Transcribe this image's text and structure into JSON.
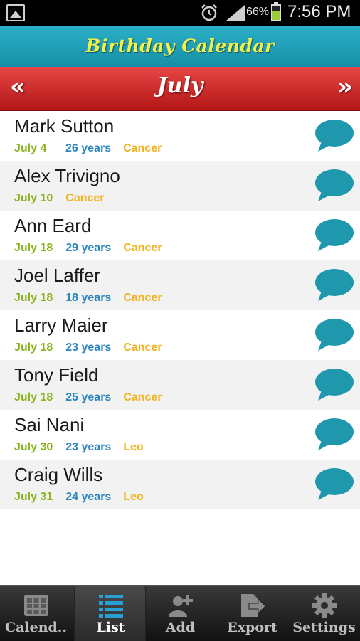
{
  "status_bar": {
    "battery_percent": "66%",
    "time": "7:56 PM",
    "icons": [
      "gallery-icon",
      "alarm-icon",
      "signal-icon",
      "battery-icon"
    ]
  },
  "header": {
    "title": "Birthday Calendar"
  },
  "month_nav": {
    "prev_label": "«",
    "month": "July",
    "next_label": "»"
  },
  "colors": {
    "title_bar": "#1a9db5",
    "title_text": "#f1f14a",
    "month_bar": "#cc2a2a",
    "date_text": "#8ab21e",
    "age_text": "#2d86c0",
    "sign_text": "#f2b21b",
    "bubble": "#1f97ad"
  },
  "birthdays": [
    {
      "name": "Mark Sutton",
      "date": "July 4",
      "age": "26 years",
      "sign": "Cancer"
    },
    {
      "name": "Alex Trivigno",
      "date": "July 10",
      "age": "",
      "sign": "Cancer"
    },
    {
      "name": "Ann Eard",
      "date": "July 18",
      "age": "29 years",
      "sign": "Cancer"
    },
    {
      "name": "Joel Laffer",
      "date": "July 18",
      "age": "18 years",
      "sign": "Cancer"
    },
    {
      "name": "Larry Maier",
      "date": "July 18",
      "age": "23 years",
      "sign": "Cancer"
    },
    {
      "name": "Tony Field",
      "date": "July 18",
      "age": "25 years",
      "sign": "Cancer"
    },
    {
      "name": "Sai Nani",
      "date": "July 30",
      "age": "23 years",
      "sign": "Leo"
    },
    {
      "name": "Craig Wills",
      "date": "July 31",
      "age": "24 years",
      "sign": "Leo"
    }
  ],
  "bottom_nav": {
    "tabs": [
      {
        "label": "Calend..",
        "icon": "calendar-icon",
        "active": false
      },
      {
        "label": "List",
        "icon": "list-icon",
        "active": true
      },
      {
        "label": "Add",
        "icon": "add-user-icon",
        "active": false
      },
      {
        "label": "Export",
        "icon": "export-icon",
        "active": false
      },
      {
        "label": "Settings",
        "icon": "gear-icon",
        "active": false
      }
    ]
  }
}
